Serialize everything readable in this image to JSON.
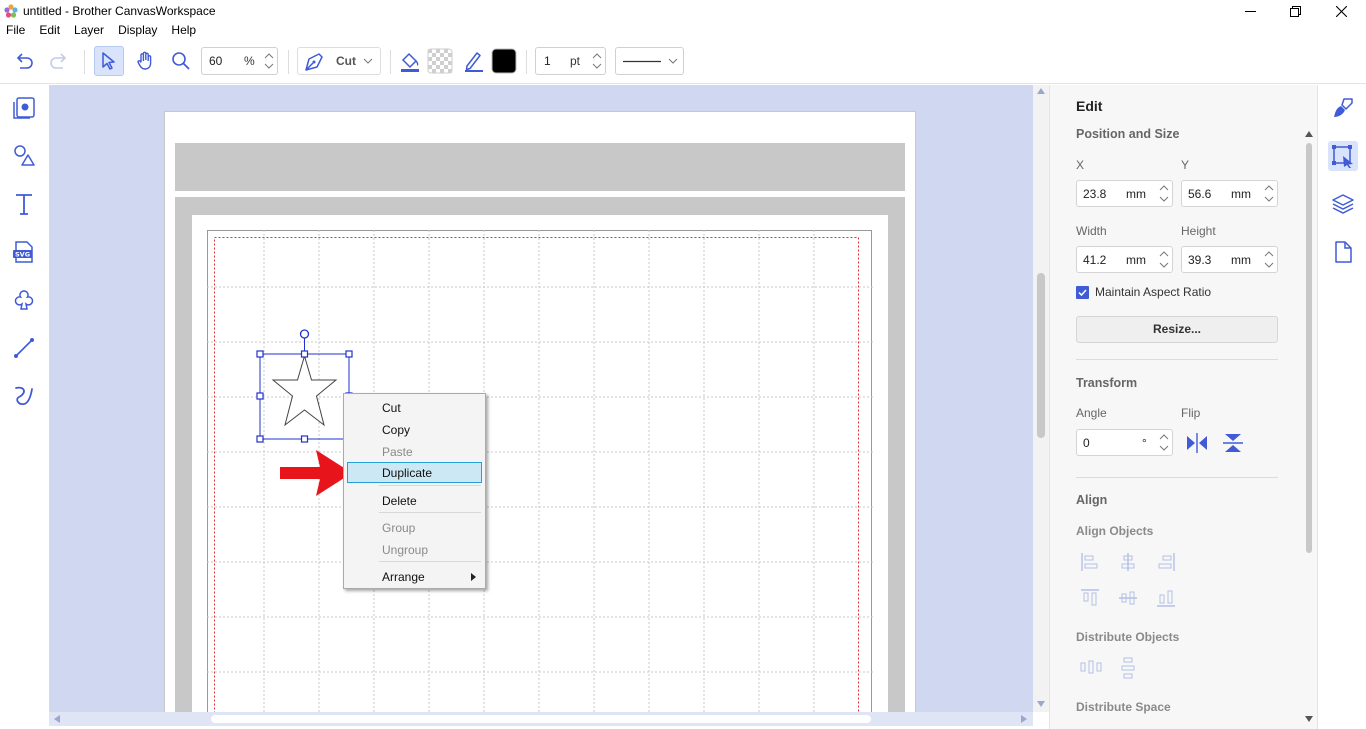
{
  "window": {
    "title": "untitled - Brother CanvasWorkspace",
    "minimize_icon": "minimize-icon",
    "maximize_icon": "restore-icon",
    "close_icon": "close-icon"
  },
  "menubar": {
    "items": [
      "File",
      "Edit",
      "Layer",
      "Display",
      "Help"
    ]
  },
  "toolbar": {
    "zoom_value": "60",
    "zoom_unit": "%",
    "mode_label": "Cut",
    "line_width_value": "1",
    "line_width_unit": "pt",
    "fill_color": "#000000"
  },
  "context_menu": {
    "items": [
      {
        "label": "Cut",
        "enabled": true
      },
      {
        "label": "Copy",
        "enabled": true
      },
      {
        "label": "Paste",
        "enabled": false
      },
      {
        "label": "Duplicate",
        "enabled": true,
        "highlighted": true
      },
      {
        "label": "Delete",
        "enabled": true
      },
      {
        "label": "Group",
        "enabled": false
      },
      {
        "label": "Ungroup",
        "enabled": false
      },
      {
        "label": "Arrange",
        "enabled": true,
        "submenu": true
      }
    ]
  },
  "edit_panel": {
    "title": "Edit",
    "position_size": {
      "heading": "Position and Size",
      "x_label": "X",
      "x_value": "23.8",
      "y_label": "Y",
      "y_value": "56.6",
      "width_label": "Width",
      "width_value": "41.2",
      "height_label": "Height",
      "height_value": "39.3",
      "unit": "mm",
      "maintain_aspect_label": "Maintain Aspect Ratio",
      "maintain_aspect_checked": true,
      "resize_button": "Resize..."
    },
    "transform": {
      "heading": "Transform",
      "angle_label": "Angle",
      "angle_value": "0",
      "angle_unit": "°",
      "flip_label": "Flip"
    },
    "align": {
      "heading": "Align",
      "align_objects_label": "Align Objects",
      "distribute_objects_label": "Distribute Objects",
      "distribute_space_label": "Distribute Space"
    }
  },
  "colors": {
    "accent": "#3f5bd6",
    "canvas_bg": "#cfd8f0",
    "selection": "#2233cc",
    "highlight": "#cce8f4",
    "arrow": "#e8141b"
  }
}
